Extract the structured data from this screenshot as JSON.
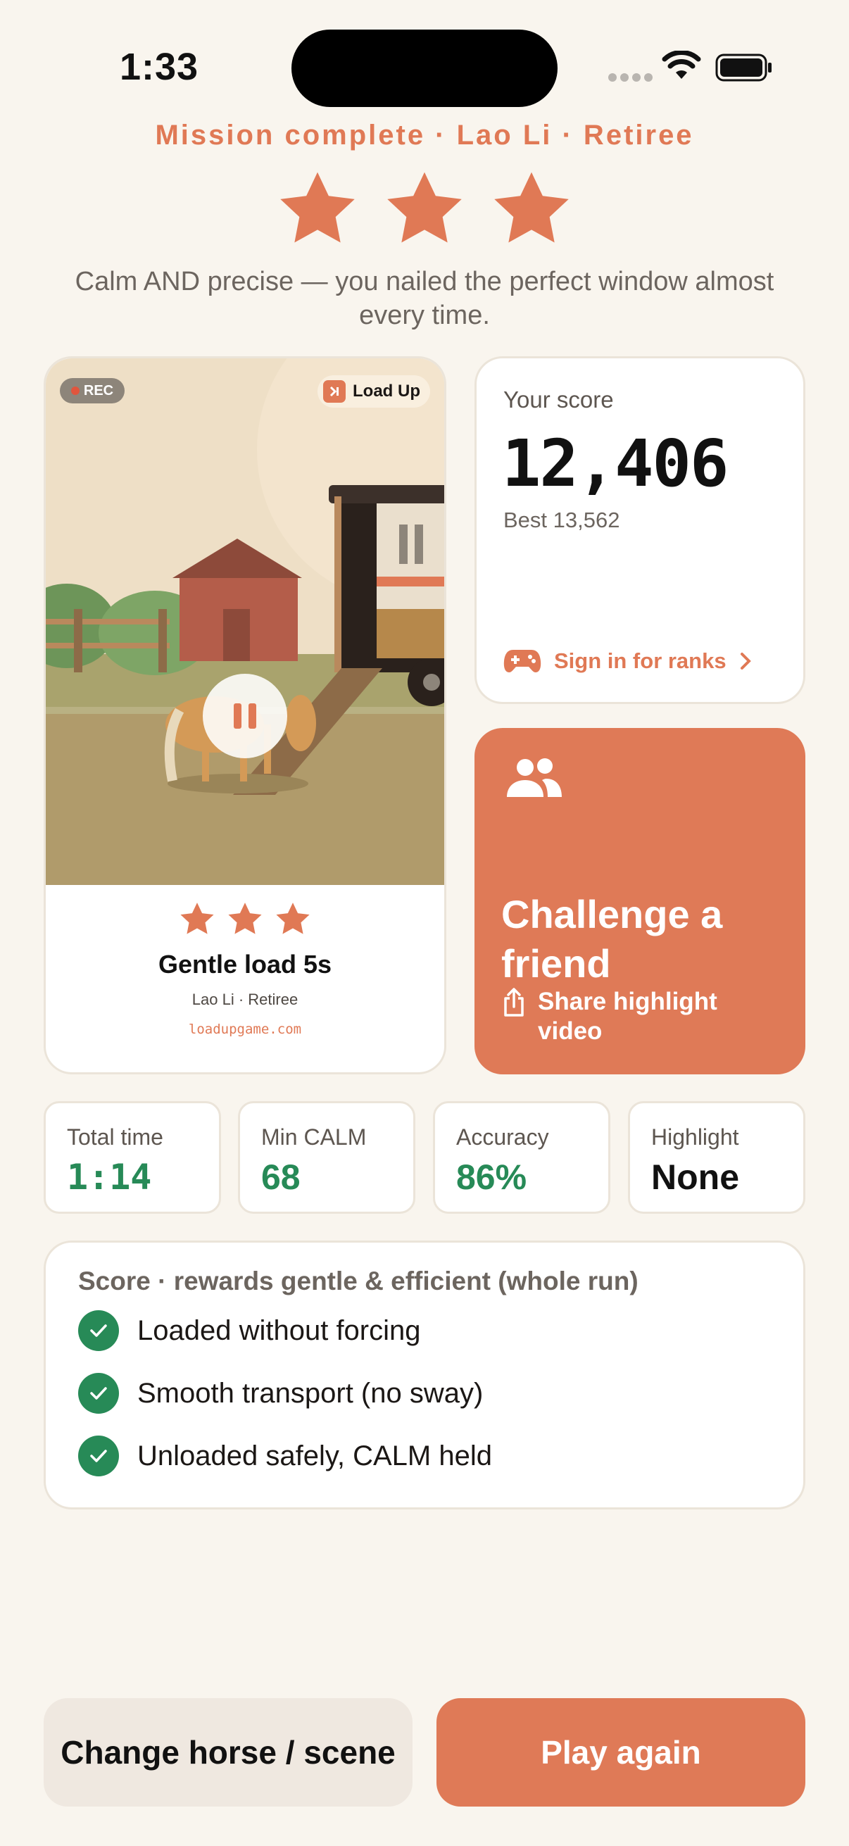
{
  "status_bar": {
    "time": "1:33"
  },
  "header": {
    "mission": "Mission complete · Lao Li · Retiree",
    "stars": 3,
    "subtitle": "Calm AND precise — you nailed the perfect window almost every time."
  },
  "video_card": {
    "rec_label": "REC",
    "brand_label": "Load Up",
    "stars": 3,
    "title": "Gentle load 5s",
    "subtitle": "Lao Li · Retiree",
    "url": "loadupgame.com"
  },
  "score_card": {
    "label": "Your score",
    "value": "12,406",
    "best": "Best 13,562",
    "sign_in_label": "Sign in for ranks"
  },
  "challenge": {
    "title": "Challenge a friend",
    "share_label": "Share highlight video"
  },
  "stats": [
    {
      "label": "Total time",
      "value": "1:14"
    },
    {
      "label": "Min CALM",
      "value": "68"
    },
    {
      "label": "Accuracy",
      "value": "86%"
    },
    {
      "label": "Highlight",
      "value": "None"
    }
  ],
  "rewards": {
    "title": "Score · rewards gentle & efficient (whole run)",
    "items": [
      "Loaded without forcing",
      "Smooth transport (no sway)",
      "Unloaded safely, CALM held"
    ]
  },
  "buttons": {
    "change": "Change horse / scene",
    "play": "Play again"
  },
  "colors": {
    "accent": "#df7a57",
    "success": "#278a57",
    "background": "#f9f5ee"
  }
}
